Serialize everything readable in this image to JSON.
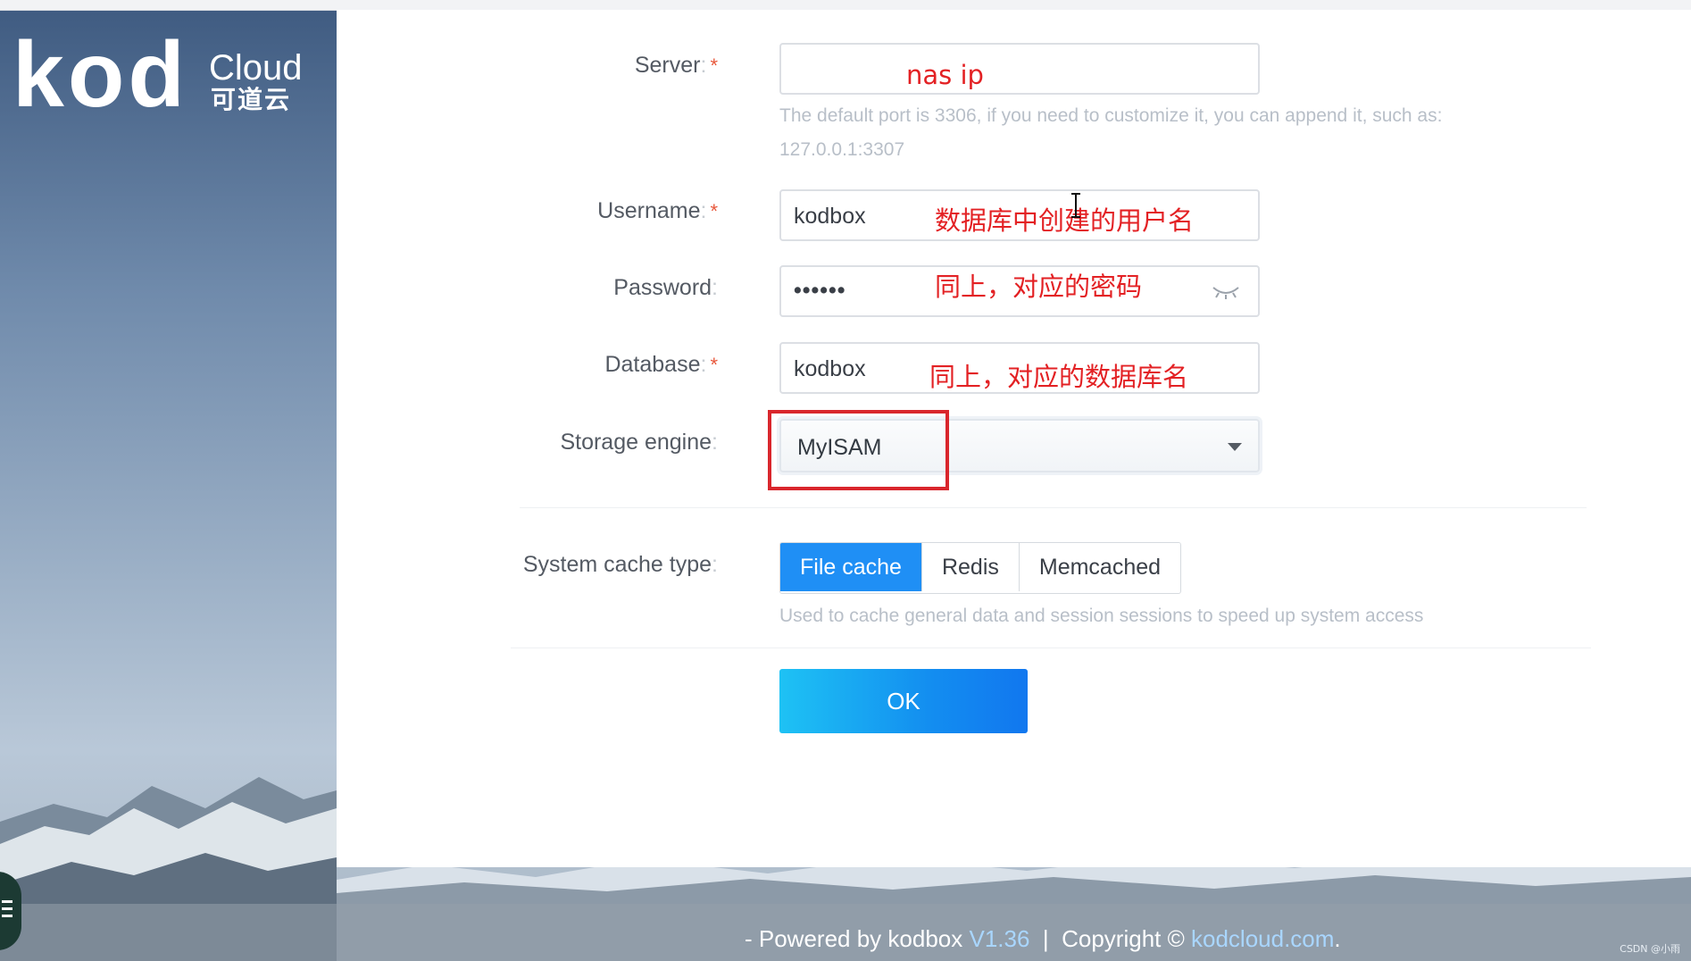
{
  "logo": {
    "primary": "kod",
    "secondary": "Cloud",
    "secondary_cn": "可道云"
  },
  "form": {
    "server": {
      "label": "Server",
      "value": "",
      "annotation": "nas ip",
      "hint": "The default port is 3306, if you need to customize it, you can append it, such as: 127.0.0.1:3307"
    },
    "username": {
      "label": "Username",
      "value": "kodbox",
      "annotation": "数据库中创建的用户名"
    },
    "password": {
      "label": "Password",
      "value_masked": "••••••",
      "annotation": "同上，对应的密码"
    },
    "database": {
      "label": "Database",
      "value": "kodbox",
      "annotation": "同上，对应的数据库名"
    },
    "storage_engine": {
      "label": "Storage engine",
      "selected": "MyISAM"
    },
    "cache": {
      "label": "System cache type",
      "options": [
        "File cache",
        "Redis",
        "Memcached"
      ],
      "selected": "File cache",
      "hint": "Used to cache general data and session sessions to speed up system access"
    },
    "submit_label": "OK",
    "required_mark": "*",
    "label_separator": ":"
  },
  "footer": {
    "prefix": "- Powered by kodbox",
    "version": "V1.36",
    "separator": "|",
    "copyright": "Copyright ©",
    "link": "kodcloud.com",
    "suffix": "."
  },
  "watermark": "CSDN @小雨",
  "colors": {
    "accent": "#1f8ff5",
    "annotation": "#e32124",
    "required": "#e8583c"
  }
}
